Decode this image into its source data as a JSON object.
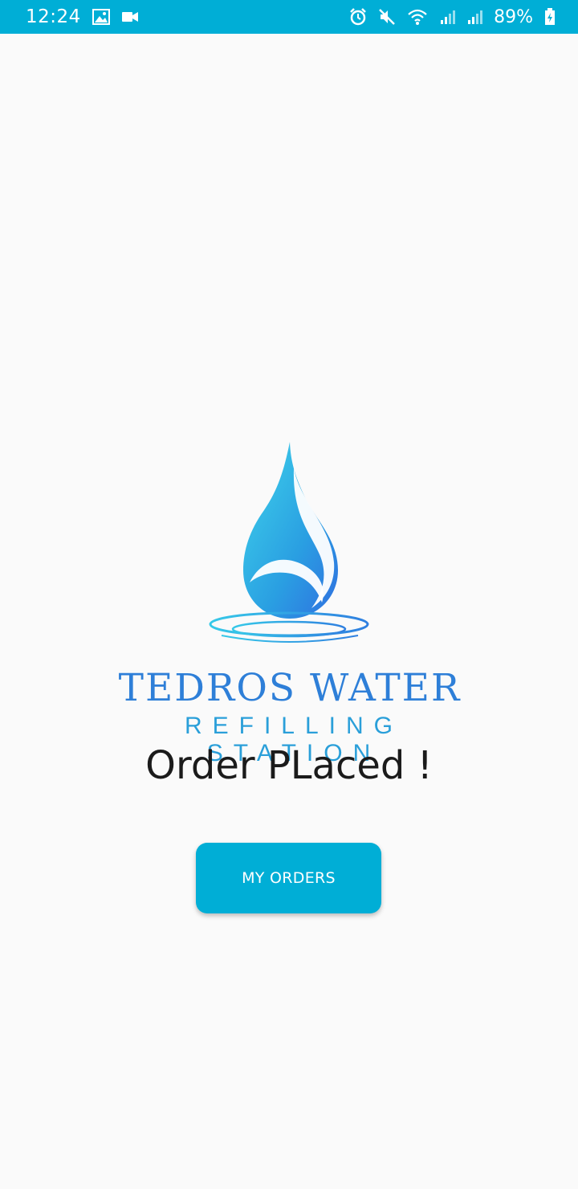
{
  "status_bar": {
    "time": "12:24",
    "battery": "89%",
    "icons": [
      "image-icon",
      "video-icon",
      "alarm-icon",
      "mute-icon",
      "wifi-icon",
      "signal-icon",
      "signal-icon",
      "battery-charging-icon"
    ],
    "background": "#00aed6"
  },
  "logo": {
    "brand_line1": "TEDROS WATER",
    "brand_line2": "REFILLING STATION",
    "icon": "water-drop-icon"
  },
  "main": {
    "title": "Order PLaced !",
    "my_orders_label": "MY ORDERS"
  },
  "colors": {
    "accent": "#00aed6",
    "brand_blue": "#2e7fd8",
    "background": "#fafafa"
  }
}
